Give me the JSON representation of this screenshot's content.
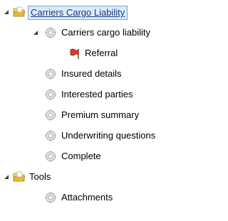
{
  "tree": {
    "root_label": "Carriers Cargo Liability",
    "children": [
      {
        "label": "Carriers cargo liability"
      },
      {
        "label": "Referral"
      },
      {
        "label": "Insured details"
      },
      {
        "label": "Interested parties"
      },
      {
        "label": "Premium summary"
      },
      {
        "label": "Underwriting questions"
      },
      {
        "label": "Complete"
      }
    ],
    "tools_label": "Tools",
    "tools_children": [
      {
        "label": "Attachments"
      }
    ]
  },
  "colors": {
    "selection_bg": "#dcebfc",
    "selection_border": "#7da2ce",
    "folder": "#e8b838",
    "gear": "#c8c8c8",
    "flag": "#d83a2a",
    "expander": "#404040"
  },
  "icons": {
    "expander": "expanded-triangle-icon",
    "folder": "folder-open-icon",
    "page": "gear-page-icon",
    "referral": "red-flag-icon"
  }
}
